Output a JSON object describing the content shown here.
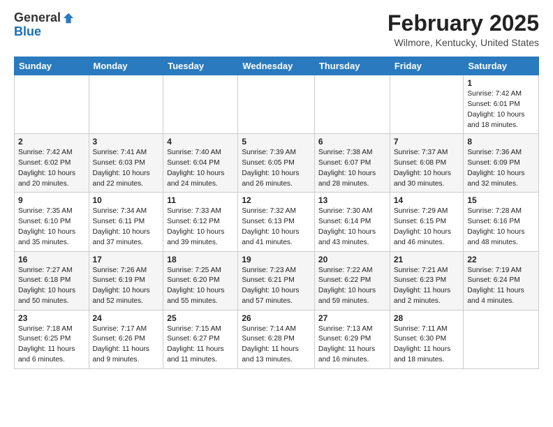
{
  "header": {
    "logo_general": "General",
    "logo_blue": "Blue",
    "month_title": "February 2025",
    "location": "Wilmore, Kentucky, United States"
  },
  "days_of_week": [
    "Sunday",
    "Monday",
    "Tuesday",
    "Wednesday",
    "Thursday",
    "Friday",
    "Saturday"
  ],
  "weeks": [
    [
      {
        "day": "",
        "info": ""
      },
      {
        "day": "",
        "info": ""
      },
      {
        "day": "",
        "info": ""
      },
      {
        "day": "",
        "info": ""
      },
      {
        "day": "",
        "info": ""
      },
      {
        "day": "",
        "info": ""
      },
      {
        "day": "1",
        "info": "Sunrise: 7:42 AM\nSunset: 6:01 PM\nDaylight: 10 hours\nand 18 minutes."
      }
    ],
    [
      {
        "day": "2",
        "info": "Sunrise: 7:42 AM\nSunset: 6:02 PM\nDaylight: 10 hours\nand 20 minutes."
      },
      {
        "day": "3",
        "info": "Sunrise: 7:41 AM\nSunset: 6:03 PM\nDaylight: 10 hours\nand 22 minutes."
      },
      {
        "day": "4",
        "info": "Sunrise: 7:40 AM\nSunset: 6:04 PM\nDaylight: 10 hours\nand 24 minutes."
      },
      {
        "day": "5",
        "info": "Sunrise: 7:39 AM\nSunset: 6:05 PM\nDaylight: 10 hours\nand 26 minutes."
      },
      {
        "day": "6",
        "info": "Sunrise: 7:38 AM\nSunset: 6:07 PM\nDaylight: 10 hours\nand 28 minutes."
      },
      {
        "day": "7",
        "info": "Sunrise: 7:37 AM\nSunset: 6:08 PM\nDaylight: 10 hours\nand 30 minutes."
      },
      {
        "day": "8",
        "info": "Sunrise: 7:36 AM\nSunset: 6:09 PM\nDaylight: 10 hours\nand 32 minutes."
      }
    ],
    [
      {
        "day": "9",
        "info": "Sunrise: 7:35 AM\nSunset: 6:10 PM\nDaylight: 10 hours\nand 35 minutes."
      },
      {
        "day": "10",
        "info": "Sunrise: 7:34 AM\nSunset: 6:11 PM\nDaylight: 10 hours\nand 37 minutes."
      },
      {
        "day": "11",
        "info": "Sunrise: 7:33 AM\nSunset: 6:12 PM\nDaylight: 10 hours\nand 39 minutes."
      },
      {
        "day": "12",
        "info": "Sunrise: 7:32 AM\nSunset: 6:13 PM\nDaylight: 10 hours\nand 41 minutes."
      },
      {
        "day": "13",
        "info": "Sunrise: 7:30 AM\nSunset: 6:14 PM\nDaylight: 10 hours\nand 43 minutes."
      },
      {
        "day": "14",
        "info": "Sunrise: 7:29 AM\nSunset: 6:15 PM\nDaylight: 10 hours\nand 46 minutes."
      },
      {
        "day": "15",
        "info": "Sunrise: 7:28 AM\nSunset: 6:16 PM\nDaylight: 10 hours\nand 48 minutes."
      }
    ],
    [
      {
        "day": "16",
        "info": "Sunrise: 7:27 AM\nSunset: 6:18 PM\nDaylight: 10 hours\nand 50 minutes."
      },
      {
        "day": "17",
        "info": "Sunrise: 7:26 AM\nSunset: 6:19 PM\nDaylight: 10 hours\nand 52 minutes."
      },
      {
        "day": "18",
        "info": "Sunrise: 7:25 AM\nSunset: 6:20 PM\nDaylight: 10 hours\nand 55 minutes."
      },
      {
        "day": "19",
        "info": "Sunrise: 7:23 AM\nSunset: 6:21 PM\nDaylight: 10 hours\nand 57 minutes."
      },
      {
        "day": "20",
        "info": "Sunrise: 7:22 AM\nSunset: 6:22 PM\nDaylight: 10 hours\nand 59 minutes."
      },
      {
        "day": "21",
        "info": "Sunrise: 7:21 AM\nSunset: 6:23 PM\nDaylight: 11 hours\nand 2 minutes."
      },
      {
        "day": "22",
        "info": "Sunrise: 7:19 AM\nSunset: 6:24 PM\nDaylight: 11 hours\nand 4 minutes."
      }
    ],
    [
      {
        "day": "23",
        "info": "Sunrise: 7:18 AM\nSunset: 6:25 PM\nDaylight: 11 hours\nand 6 minutes."
      },
      {
        "day": "24",
        "info": "Sunrise: 7:17 AM\nSunset: 6:26 PM\nDaylight: 11 hours\nand 9 minutes."
      },
      {
        "day": "25",
        "info": "Sunrise: 7:15 AM\nSunset: 6:27 PM\nDaylight: 11 hours\nand 11 minutes."
      },
      {
        "day": "26",
        "info": "Sunrise: 7:14 AM\nSunset: 6:28 PM\nDaylight: 11 hours\nand 13 minutes."
      },
      {
        "day": "27",
        "info": "Sunrise: 7:13 AM\nSunset: 6:29 PM\nDaylight: 11 hours\nand 16 minutes."
      },
      {
        "day": "28",
        "info": "Sunrise: 7:11 AM\nSunset: 6:30 PM\nDaylight: 11 hours\nand 18 minutes."
      },
      {
        "day": "",
        "info": ""
      }
    ]
  ]
}
